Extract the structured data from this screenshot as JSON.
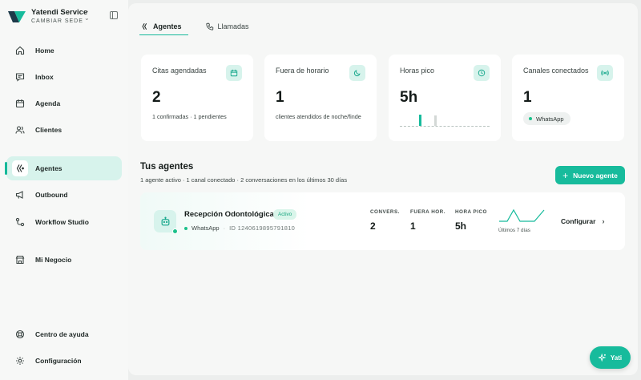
{
  "brand": {
    "name": "Yatendi Service",
    "subtitle": "CAMBIAR SEDE"
  },
  "sidebar": {
    "items": [
      {
        "label": "Home",
        "icon": "home-icon"
      },
      {
        "label": "Inbox",
        "icon": "inbox-icon"
      },
      {
        "label": "Agenda",
        "icon": "calendar-icon"
      },
      {
        "label": "Clientes",
        "icon": "users-icon"
      },
      {
        "label": "Agentes",
        "icon": "agent-icon",
        "active": true
      },
      {
        "label": "Outbound",
        "icon": "megaphone-icon"
      },
      {
        "label": "Workflow Studio",
        "icon": "workflow-icon"
      },
      {
        "label": "Mi Negocio",
        "icon": "store-icon"
      }
    ],
    "footer": [
      {
        "label": "Centro de ayuda",
        "icon": "lifebuoy-icon"
      },
      {
        "label": "Configuración",
        "icon": "gear-icon"
      }
    ]
  },
  "tabs": [
    {
      "label": "Agentes",
      "active": true
    },
    {
      "label": "Llamadas",
      "active": false
    }
  ],
  "cards": {
    "citas": {
      "title": "Citas agendadas",
      "value": "2",
      "sub": "1 confirmadas · 1 pendientes",
      "icon": "calendar-icon"
    },
    "fuera": {
      "title": "Fuera de horario",
      "value": "1",
      "sub": "clientes atendidos de noche/finde",
      "icon": "moon-icon"
    },
    "pico": {
      "title": "Horas pico",
      "value": "5h",
      "icon": "clock-icon"
    },
    "canales": {
      "title": "Canales conectados",
      "value": "1",
      "channel": "WhatsApp",
      "icon": "broadcast-icon"
    }
  },
  "agents_section": {
    "title": "Tus agentes",
    "subtitle": "1 agente activo · 1 canal conectado · 2 conversaciones en los últimos 30 días",
    "new_button": "Nuevo agente"
  },
  "agent": {
    "name": "Recepción Odontológica",
    "status": "Activo",
    "channel": "WhatsApp",
    "id_text": "ID 1240619895791810",
    "stats": [
      {
        "label": "CONVERS.",
        "value": "2"
      },
      {
        "label": "FUERA HOR.",
        "value": "1"
      },
      {
        "label": "HORA PICO",
        "value": "5h"
      }
    ],
    "chart_caption": "Últimos 7 días",
    "configure_label": "Configurar"
  },
  "fab": {
    "label": "Yati"
  },
  "colors": {
    "accent": "#17bb9c",
    "accent_light": "#d7f3ec",
    "online": "#1cc08a"
  }
}
